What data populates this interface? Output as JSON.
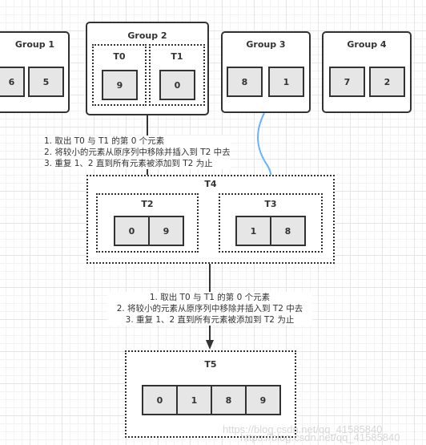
{
  "groups": [
    {
      "title": "Group 1",
      "values": [
        "6",
        "5"
      ]
    },
    {
      "title": "Group 2",
      "sub": [
        {
          "title": "T0",
          "value": "9"
        },
        {
          "title": "T1",
          "value": "0"
        }
      ]
    },
    {
      "title": "Group 3",
      "values": [
        "8",
        "1"
      ]
    },
    {
      "title": "Group 4",
      "values": [
        "7",
        "2"
      ]
    }
  ],
  "steps": [
    "1. 取出 T0 与 T1 的第 0 个元素",
    "2. 将较小的元素从原序列中移除并插入到 T2 中去",
    "3. 重复 1、2 直到所有元素被添加到 T2 为止"
  ],
  "t4": {
    "title": "T4",
    "t2": {
      "title": "T2",
      "values": [
        "0",
        "9"
      ]
    },
    "t3": {
      "title": "T3",
      "values": [
        "1",
        "8"
      ]
    }
  },
  "t5": {
    "title": "T5",
    "values": [
      "0",
      "1",
      "8",
      "9"
    ]
  },
  "watermark": "https://blog.csdn.net/qq_41585840",
  "colors": {
    "line": "#333333",
    "blue_arrow": "#66b2ff",
    "cell_fill": "#e6e6e6"
  }
}
